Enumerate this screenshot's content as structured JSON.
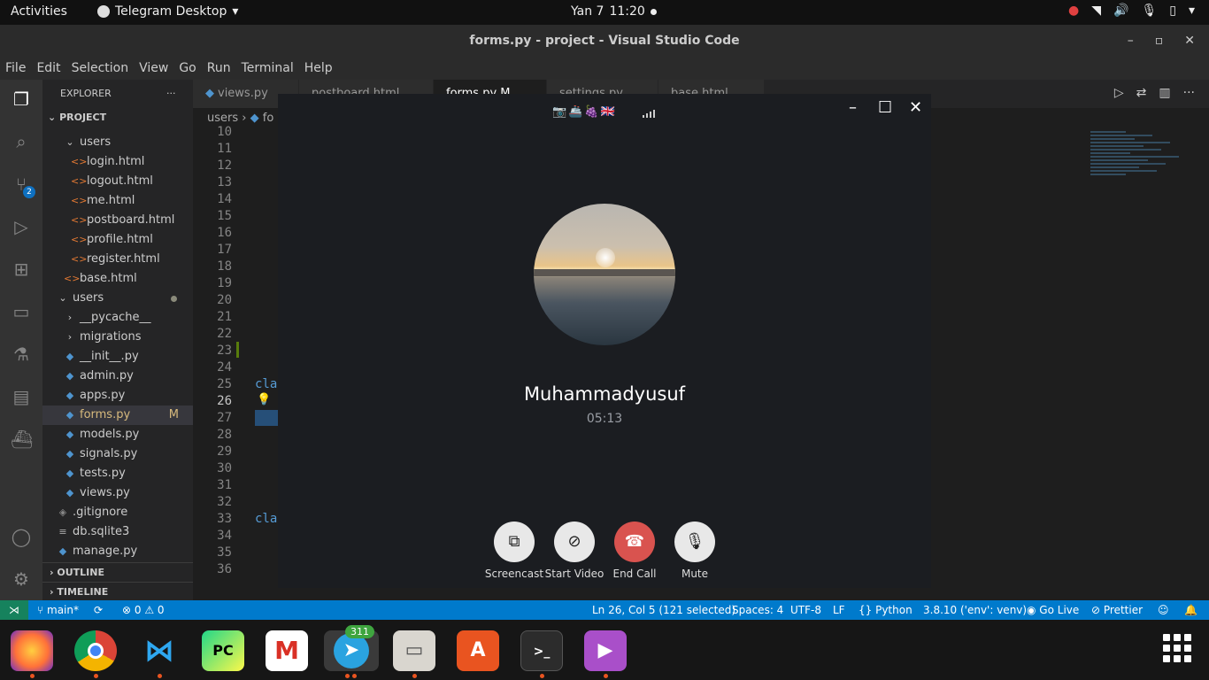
{
  "topbar": {
    "activities": "Activities",
    "app_menu": "Telegram Desktop",
    "date": "Yan 7",
    "time": "11:20"
  },
  "window": {
    "title": "forms.py - project - Visual Studio Code"
  },
  "menu": [
    "File",
    "Edit",
    "Selection",
    "View",
    "Go",
    "Run",
    "Terminal",
    "Help"
  ],
  "activitybar": {
    "source_control_badge": "2"
  },
  "sidebar": {
    "header": "EXPLORER",
    "project_label": "PROJECT",
    "items": [
      {
        "label": "users",
        "kind": "folder"
      },
      {
        "label": "login.html",
        "kind": "html"
      },
      {
        "label": "logout.html",
        "kind": "html"
      },
      {
        "label": "me.html",
        "kind": "html"
      },
      {
        "label": "postboard.html",
        "kind": "html"
      },
      {
        "label": "profile.html",
        "kind": "html"
      },
      {
        "label": "register.html",
        "kind": "html"
      },
      {
        "label": "base.html",
        "kind": "html"
      },
      {
        "label": "users",
        "kind": "folder"
      },
      {
        "label": "__pycache__",
        "kind": "folder-closed"
      },
      {
        "label": "migrations",
        "kind": "folder-closed"
      },
      {
        "label": "__init__.py",
        "kind": "py"
      },
      {
        "label": "admin.py",
        "kind": "py"
      },
      {
        "label": "apps.py",
        "kind": "py"
      },
      {
        "label": "forms.py",
        "kind": "py",
        "status": "M"
      },
      {
        "label": "models.py",
        "kind": "py"
      },
      {
        "label": "signals.py",
        "kind": "py"
      },
      {
        "label": "tests.py",
        "kind": "py"
      },
      {
        "label": "views.py",
        "kind": "py"
      },
      {
        "label": ".gitignore",
        "kind": "git"
      },
      {
        "label": "db.sqlite3",
        "kind": "db"
      },
      {
        "label": "manage.py",
        "kind": "py"
      }
    ],
    "outline": "OUTLINE",
    "timeline": "TIMELINE"
  },
  "tabs": [
    {
      "label": "views.py"
    },
    {
      "label": "postboard.html"
    },
    {
      "label": "forms.py M"
    },
    {
      "label": "settings.py"
    },
    {
      "label": "base.html"
    }
  ],
  "breadcrumb": {
    "folder": "users",
    "file": "fo"
  },
  "editor": {
    "line_numbers": [
      "10",
      "11",
      "12",
      "13",
      "14",
      "15",
      "16",
      "17",
      "18",
      "19",
      "20",
      "21",
      "22",
      "23",
      "24",
      "25",
      "26",
      "27",
      "28",
      "29",
      "30",
      "31",
      "32",
      "33",
      "34",
      "35",
      "36"
    ],
    "code_fragment_1": "cla",
    "code_fragment_2": "cla",
    "current_line": "26"
  },
  "call": {
    "emojis": "📷🚢🍇🇬🇧",
    "name": "Muhammadyusuf",
    "duration": "05:13",
    "buttons": {
      "screencast": "Screencast",
      "start_video": "Start Video",
      "end_call": "End Call",
      "mute": "Mute"
    }
  },
  "statusbar": {
    "branch": "main*",
    "problems": "⊗ 0 ⚠ 0",
    "position": "Ln 26, Col 5 (121 selected)",
    "spaces": "Spaces: 4",
    "encoding": "UTF-8",
    "eol": "LF",
    "language": "Python",
    "interpreter": "3.8.10 ('env': venv)",
    "golive": "Go Live",
    "prettier": "Prettier"
  },
  "dock": {
    "telegram_badge": "311",
    "pycharm_label": "PC",
    "terminal_label": ">_"
  },
  "colors": {
    "status_bar": "#007acc",
    "end_call": "#d9534f",
    "call_bg": "#1b1d21"
  }
}
